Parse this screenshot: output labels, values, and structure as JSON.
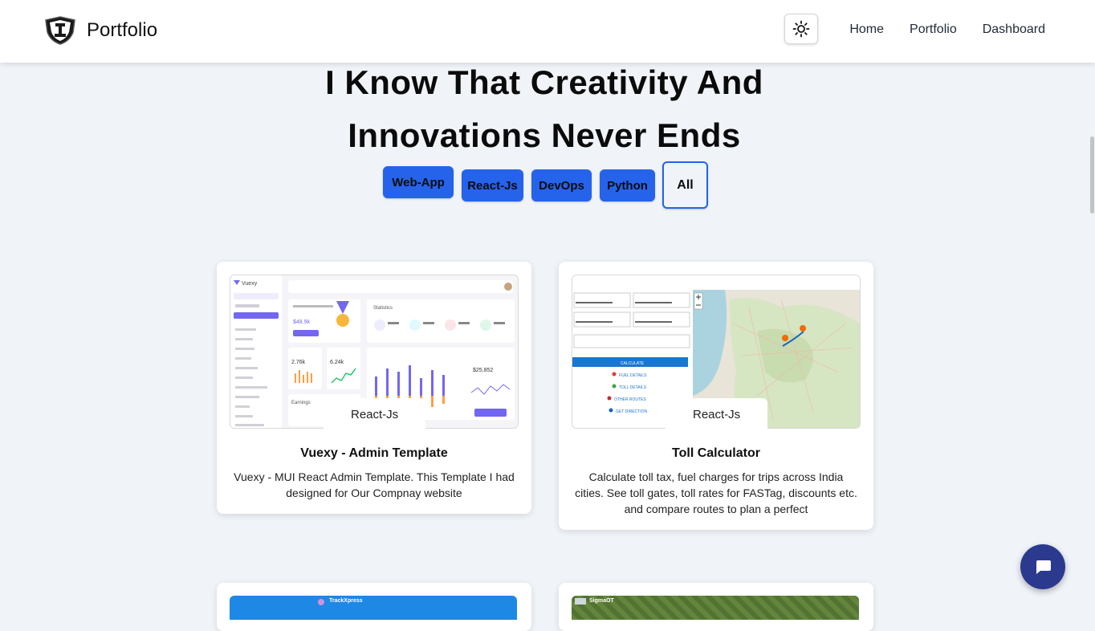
{
  "navbar": {
    "brand": "Portfolio",
    "links": [
      "Home",
      "Portfolio",
      "Dashboard"
    ]
  },
  "hero": {
    "line1": "I Know That Creativity And",
    "line2": "Innovations Never Ends"
  },
  "filters": [
    "Web-App",
    "React-Js",
    "DevOps",
    "Python",
    "All"
  ],
  "projects": [
    {
      "tag": "React-Js",
      "title": "Vuexy - Admin Template",
      "description": "Vuexy - MUI React Admin Template. This Template I had designed for Our Compnay website",
      "preview": {
        "brand": "Vuexy",
        "stats_label": "Statistics",
        "value1": "$48.9k",
        "value2": "2.76k",
        "value3": "6.24k",
        "value4": "$25,852",
        "earnings": "Earnings"
      }
    },
    {
      "tag": "React-Js",
      "title": "Toll Calculator",
      "description": "Calculate toll tax, fuel charges for trips across India cities. See toll gates, toll rates for FASTag, discounts etc. and compare routes to plan a perfect",
      "preview": {
        "calculate": "CALCULATE",
        "fuel": "FUEL DETAILS",
        "toll": "TOLL DETAILS",
        "route": "OTHER ROUTES",
        "direction": "GET DIRECTION"
      }
    }
  ],
  "next_projects": [
    "TrackXpress",
    "SigmaOT"
  ],
  "colors": {
    "accent": "#2563eb",
    "chat": "#2b3a8f",
    "background": "#f0f4f8"
  },
  "icons": {
    "theme": "sun-icon",
    "chat": "chat-bubble-icon",
    "logo": "shield-logo-icon"
  }
}
